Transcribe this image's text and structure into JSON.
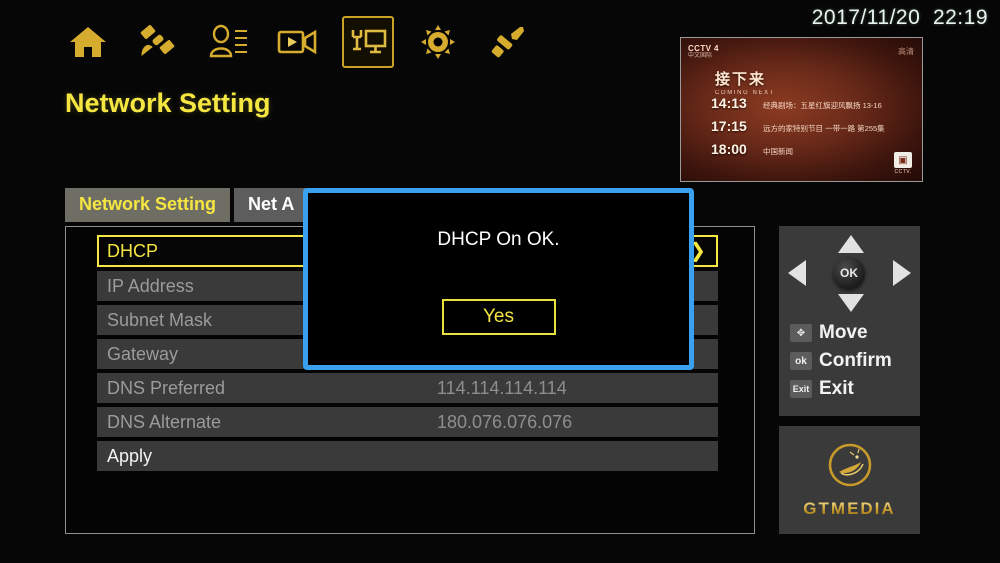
{
  "clock": "2017/11/20  22:19",
  "page_title": "Network Setting",
  "colors": {
    "gold": "#c9a227",
    "yellow": "#f5e642",
    "dialog_border": "#3aa0f0",
    "row_bg": "#3a3a3a",
    "panel_border": "#8e8e8e"
  },
  "navbar": {
    "items": [
      {
        "icon": "home-icon",
        "selected": false
      },
      {
        "icon": "satellite-icon",
        "selected": false
      },
      {
        "icon": "user-list-icon",
        "selected": false
      },
      {
        "icon": "video-camera-icon",
        "selected": false
      },
      {
        "icon": "tv-antenna-icon",
        "selected": true
      },
      {
        "icon": "gear-icon",
        "selected": false
      },
      {
        "icon": "wrench-icon",
        "selected": false
      }
    ]
  },
  "preview": {
    "channel": "CCTV",
    "channel_number": "4",
    "channel_sub": "中文国际",
    "quality": "高清",
    "next_cn": "接下来",
    "next_en": "COMING NEXT",
    "schedule": [
      {
        "time": "14:13",
        "desc": "经典剧场：五星红旗迎风飘扬  13-16"
      },
      {
        "time": "17:15",
        "desc": "远方的家特别节目  一带一路  第255集"
      },
      {
        "time": "18:00",
        "desc": "中国新闻"
      }
    ],
    "watermark": "CCTV."
  },
  "tabs": [
    {
      "label": "Network Setting",
      "active": true
    },
    {
      "label": "Net A",
      "active": false
    }
  ],
  "settings_rows": [
    {
      "label": "DHCP",
      "value": "",
      "selected": true,
      "chevron": "❯"
    },
    {
      "label": "IP Address",
      "value": "",
      "selected": false,
      "chevron": ""
    },
    {
      "label": "Subnet Mask",
      "value": "",
      "selected": false,
      "chevron": ""
    },
    {
      "label": "Gateway",
      "value": "",
      "selected": false,
      "chevron": ""
    },
    {
      "label": "DNS Preferred",
      "value": "114.114.114.114",
      "selected": false,
      "chevron": ""
    },
    {
      "label": "DNS Alternate",
      "value": "180.076.076.076",
      "selected": false,
      "chevron": ""
    },
    {
      "label": "Apply",
      "value": "",
      "selected": false,
      "chevron": ""
    }
  ],
  "sidebar": {
    "ok_label": "OK",
    "legend": [
      {
        "badge": "✥",
        "badge_name": "dpad-badge-icon",
        "label": "Move"
      },
      {
        "badge": "ok",
        "badge_name": "ok-badge-icon",
        "label": "Confirm"
      },
      {
        "badge": "Exit",
        "badge_name": "exit-badge-icon",
        "label": "Exit"
      }
    ]
  },
  "brand": {
    "name": "GTMEDIA"
  },
  "dialog": {
    "message": "DHCP On OK.",
    "confirm_label": "Yes"
  }
}
